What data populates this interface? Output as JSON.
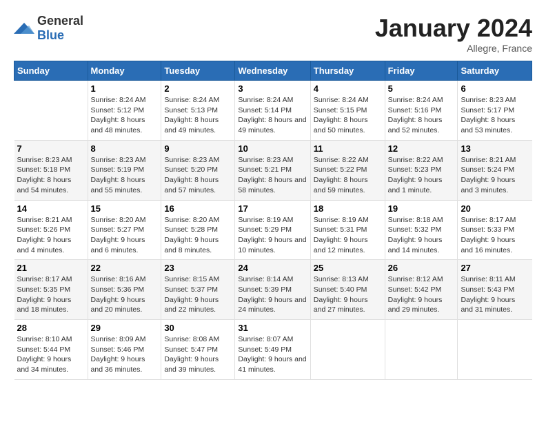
{
  "logo": {
    "general": "General",
    "blue": "Blue"
  },
  "title": "January 2024",
  "location": "Allegre, France",
  "weekdays": [
    "Sunday",
    "Monday",
    "Tuesday",
    "Wednesday",
    "Thursday",
    "Friday",
    "Saturday"
  ],
  "weeks": [
    [
      {
        "day": "",
        "sunrise": "",
        "sunset": "",
        "daylight": ""
      },
      {
        "day": "1",
        "sunrise": "Sunrise: 8:24 AM",
        "sunset": "Sunset: 5:12 PM",
        "daylight": "Daylight: 8 hours and 48 minutes."
      },
      {
        "day": "2",
        "sunrise": "Sunrise: 8:24 AM",
        "sunset": "Sunset: 5:13 PM",
        "daylight": "Daylight: 8 hours and 49 minutes."
      },
      {
        "day": "3",
        "sunrise": "Sunrise: 8:24 AM",
        "sunset": "Sunset: 5:14 PM",
        "daylight": "Daylight: 8 hours and 49 minutes."
      },
      {
        "day": "4",
        "sunrise": "Sunrise: 8:24 AM",
        "sunset": "Sunset: 5:15 PM",
        "daylight": "Daylight: 8 hours and 50 minutes."
      },
      {
        "day": "5",
        "sunrise": "Sunrise: 8:24 AM",
        "sunset": "Sunset: 5:16 PM",
        "daylight": "Daylight: 8 hours and 52 minutes."
      },
      {
        "day": "6",
        "sunrise": "Sunrise: 8:23 AM",
        "sunset": "Sunset: 5:17 PM",
        "daylight": "Daylight: 8 hours and 53 minutes."
      }
    ],
    [
      {
        "day": "7",
        "sunrise": "Sunrise: 8:23 AM",
        "sunset": "Sunset: 5:18 PM",
        "daylight": "Daylight: 8 hours and 54 minutes."
      },
      {
        "day": "8",
        "sunrise": "Sunrise: 8:23 AM",
        "sunset": "Sunset: 5:19 PM",
        "daylight": "Daylight: 8 hours and 55 minutes."
      },
      {
        "day": "9",
        "sunrise": "Sunrise: 8:23 AM",
        "sunset": "Sunset: 5:20 PM",
        "daylight": "Daylight: 8 hours and 57 minutes."
      },
      {
        "day": "10",
        "sunrise": "Sunrise: 8:23 AM",
        "sunset": "Sunset: 5:21 PM",
        "daylight": "Daylight: 8 hours and 58 minutes."
      },
      {
        "day": "11",
        "sunrise": "Sunrise: 8:22 AM",
        "sunset": "Sunset: 5:22 PM",
        "daylight": "Daylight: 8 hours and 59 minutes."
      },
      {
        "day": "12",
        "sunrise": "Sunrise: 8:22 AM",
        "sunset": "Sunset: 5:23 PM",
        "daylight": "Daylight: 9 hours and 1 minute."
      },
      {
        "day": "13",
        "sunrise": "Sunrise: 8:21 AM",
        "sunset": "Sunset: 5:24 PM",
        "daylight": "Daylight: 9 hours and 3 minutes."
      }
    ],
    [
      {
        "day": "14",
        "sunrise": "Sunrise: 8:21 AM",
        "sunset": "Sunset: 5:26 PM",
        "daylight": "Daylight: 9 hours and 4 minutes."
      },
      {
        "day": "15",
        "sunrise": "Sunrise: 8:20 AM",
        "sunset": "Sunset: 5:27 PM",
        "daylight": "Daylight: 9 hours and 6 minutes."
      },
      {
        "day": "16",
        "sunrise": "Sunrise: 8:20 AM",
        "sunset": "Sunset: 5:28 PM",
        "daylight": "Daylight: 9 hours and 8 minutes."
      },
      {
        "day": "17",
        "sunrise": "Sunrise: 8:19 AM",
        "sunset": "Sunset: 5:29 PM",
        "daylight": "Daylight: 9 hours and 10 minutes."
      },
      {
        "day": "18",
        "sunrise": "Sunrise: 8:19 AM",
        "sunset": "Sunset: 5:31 PM",
        "daylight": "Daylight: 9 hours and 12 minutes."
      },
      {
        "day": "19",
        "sunrise": "Sunrise: 8:18 AM",
        "sunset": "Sunset: 5:32 PM",
        "daylight": "Daylight: 9 hours and 14 minutes."
      },
      {
        "day": "20",
        "sunrise": "Sunrise: 8:17 AM",
        "sunset": "Sunset: 5:33 PM",
        "daylight": "Daylight: 9 hours and 16 minutes."
      }
    ],
    [
      {
        "day": "21",
        "sunrise": "Sunrise: 8:17 AM",
        "sunset": "Sunset: 5:35 PM",
        "daylight": "Daylight: 9 hours and 18 minutes."
      },
      {
        "day": "22",
        "sunrise": "Sunrise: 8:16 AM",
        "sunset": "Sunset: 5:36 PM",
        "daylight": "Daylight: 9 hours and 20 minutes."
      },
      {
        "day": "23",
        "sunrise": "Sunrise: 8:15 AM",
        "sunset": "Sunset: 5:37 PM",
        "daylight": "Daylight: 9 hours and 22 minutes."
      },
      {
        "day": "24",
        "sunrise": "Sunrise: 8:14 AM",
        "sunset": "Sunset: 5:39 PM",
        "daylight": "Daylight: 9 hours and 24 minutes."
      },
      {
        "day": "25",
        "sunrise": "Sunrise: 8:13 AM",
        "sunset": "Sunset: 5:40 PM",
        "daylight": "Daylight: 9 hours and 27 minutes."
      },
      {
        "day": "26",
        "sunrise": "Sunrise: 8:12 AM",
        "sunset": "Sunset: 5:42 PM",
        "daylight": "Daylight: 9 hours and 29 minutes."
      },
      {
        "day": "27",
        "sunrise": "Sunrise: 8:11 AM",
        "sunset": "Sunset: 5:43 PM",
        "daylight": "Daylight: 9 hours and 31 minutes."
      }
    ],
    [
      {
        "day": "28",
        "sunrise": "Sunrise: 8:10 AM",
        "sunset": "Sunset: 5:44 PM",
        "daylight": "Daylight: 9 hours and 34 minutes."
      },
      {
        "day": "29",
        "sunrise": "Sunrise: 8:09 AM",
        "sunset": "Sunset: 5:46 PM",
        "daylight": "Daylight: 9 hours and 36 minutes."
      },
      {
        "day": "30",
        "sunrise": "Sunrise: 8:08 AM",
        "sunset": "Sunset: 5:47 PM",
        "daylight": "Daylight: 9 hours and 39 minutes."
      },
      {
        "day": "31",
        "sunrise": "Sunrise: 8:07 AM",
        "sunset": "Sunset: 5:49 PM",
        "daylight": "Daylight: 9 hours and 41 minutes."
      },
      {
        "day": "",
        "sunrise": "",
        "sunset": "",
        "daylight": ""
      },
      {
        "day": "",
        "sunrise": "",
        "sunset": "",
        "daylight": ""
      },
      {
        "day": "",
        "sunrise": "",
        "sunset": "",
        "daylight": ""
      }
    ]
  ]
}
